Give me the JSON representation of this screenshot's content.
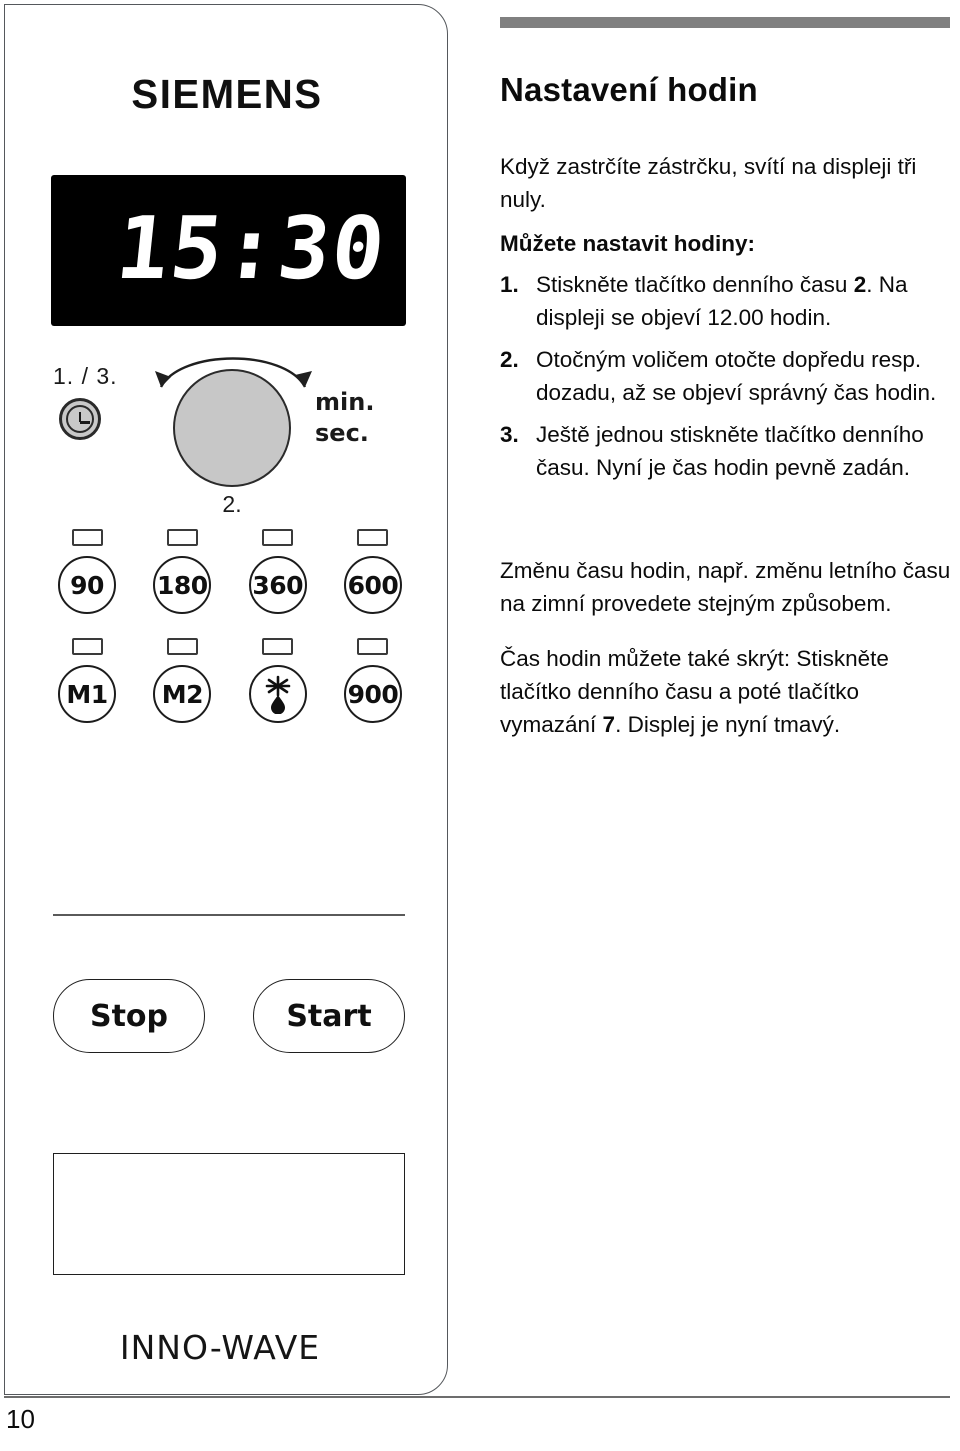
{
  "document": {
    "page_number": "10"
  },
  "appliance": {
    "brand": "SIEMENS",
    "model_name": "INNO-WAVE",
    "display_time": "15:30",
    "clock_step_label": "1. / 3.",
    "dial_step_label": "2.",
    "unit_minutes": "min.",
    "unit_seconds": "sec.",
    "clock_icon_name": "clock-icon",
    "dial_icon_name": "rotary-selector",
    "power_buttons_row1": [
      "90",
      "180",
      "360",
      "600"
    ],
    "power_buttons_row2": [
      "M1",
      "M2",
      "",
      "900"
    ],
    "defrost_icon_name": "snowflake-droplet-icon",
    "stop_label": "Stop",
    "start_label": "Start"
  },
  "content": {
    "title": "Nastavení hodin",
    "intro": "Když zastrčíte zástrčku, svítí na displeji tři nuly.",
    "steps_heading": "Můžete nastavit hodiny:",
    "steps": [
      {
        "number": "1.",
        "text_before": "Stiskněte tlačítko denního času ",
        "bold": "2",
        "text_after": ". Na displeji se objeví 12.00 hodin."
      },
      {
        "number": "2.",
        "text_before": "Otočným voličem otočte dopředu resp. dozadu, až se objeví správný čas hodin.",
        "bold": "",
        "text_after": ""
      },
      {
        "number": "3.",
        "text_before": "Ještě jednou stiskněte tlačítko denního času. Nyní je čas hodin pevně zadán.",
        "bold": "",
        "text_after": ""
      }
    ],
    "notes": [
      {
        "text_before": "Změnu času hodin, např. změnu letního času na zimní provedete stejným způsobem.",
        "bold": "",
        "text_after": ""
      },
      {
        "text_before": "Čas hodin můžete také skrýt: Stiskněte tlačítko denního času a poté tlačítko vymazání ",
        "bold": "7",
        "text_after": ". Displej je nyní tmavý."
      }
    ]
  },
  "colors": {
    "header_rule": "#808080",
    "text": "#0b0b0b",
    "lcd_background": "#000000",
    "lcd_text": "#ffffff",
    "dial_fill": "#c7c7c7"
  }
}
